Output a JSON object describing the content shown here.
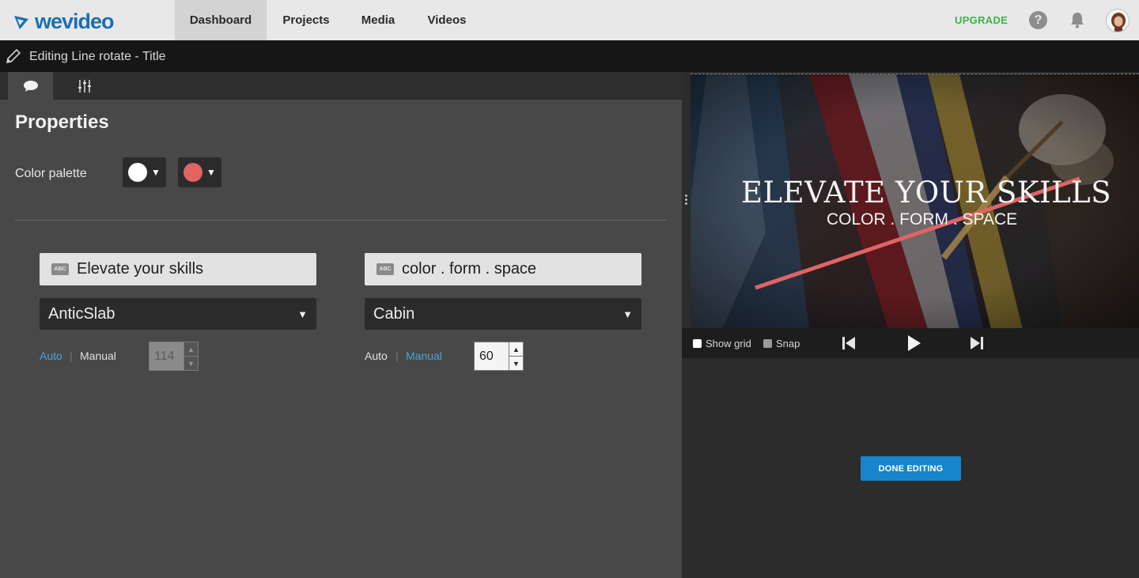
{
  "app": {
    "logo_text": "wevideo",
    "nav": [
      {
        "label": "Dashboard",
        "active": true
      },
      {
        "label": "Projects",
        "active": false
      },
      {
        "label": "Media",
        "active": false
      },
      {
        "label": "Videos",
        "active": false
      }
    ],
    "upgrade_label": "UPGRADE",
    "help_glyph": "?",
    "colors": {
      "brand": "#1a6fb6",
      "upgrade": "#3db34a",
      "accent": "#1685cc",
      "link_active": "#4aa3dc"
    }
  },
  "editor": {
    "title": "Editing Line rotate - Title",
    "tabs": [
      {
        "icon": "speech-bubble-icon",
        "active": true
      },
      {
        "icon": "sliders-icon",
        "active": false
      }
    ],
    "properties_title": "Properties",
    "color_palette_label": "Color palette",
    "swatches": [
      {
        "color": "#ffffff"
      },
      {
        "color": "#e06464"
      }
    ],
    "text_blocks": [
      {
        "abc_label": "ABC",
        "text": "Elevate your skills",
        "font": "AnticSlab",
        "mode_auto": "Auto",
        "mode_manual": "Manual",
        "active_mode": "manual",
        "size": "114",
        "size_enabled": false
      },
      {
        "abc_label": "ABC",
        "text": "color . form . space",
        "font": "Cabin",
        "mode_auto": "Auto",
        "mode_manual": "Manual",
        "active_mode": "auto",
        "size": "60",
        "size_enabled": true
      }
    ]
  },
  "preview": {
    "title_text": "ELEVATE YOUR SKILLS",
    "subtitle_text": "COLOR . FORM . SPACE",
    "line_color": "#e06464",
    "show_grid_label": "Show grid",
    "snap_label": "Snap",
    "done_label": "DONE EDITING"
  }
}
